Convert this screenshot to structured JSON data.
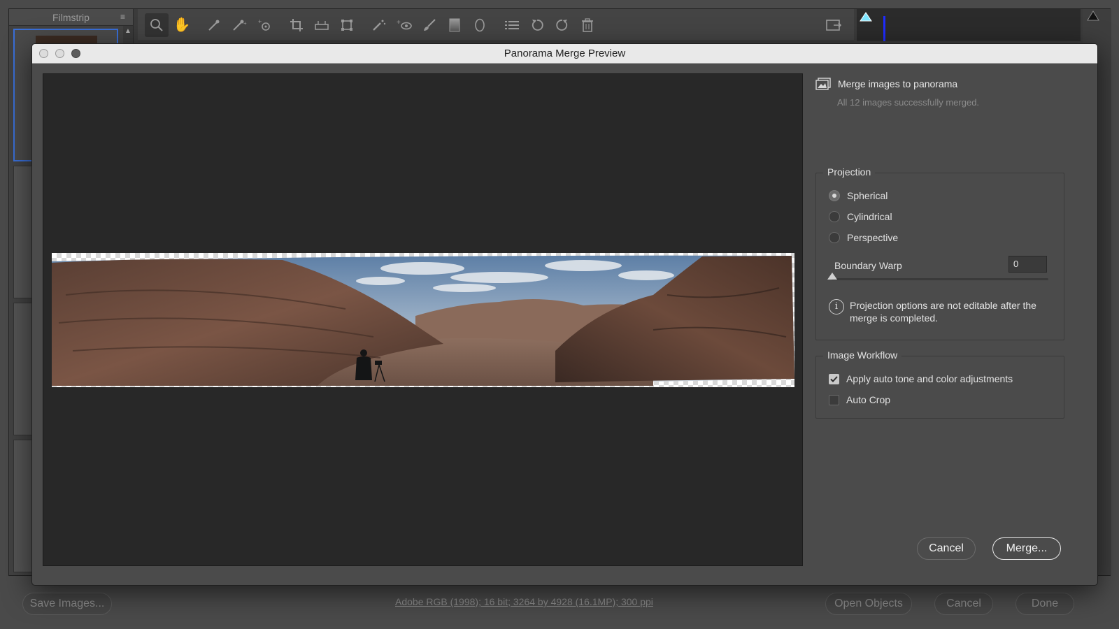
{
  "background": {
    "filmstrip": {
      "title": "Filmstrip"
    },
    "toolbar": {
      "tools": [
        "zoom-icon",
        "hand-icon",
        "white-balance-icon",
        "color-sampler-icon",
        "targeted-adjustment-icon",
        "crop-icon",
        "straighten-icon",
        "transform-icon",
        "spot-removal-icon",
        "red-eye-icon",
        "adjustment-brush-icon",
        "graduated-filter-icon",
        "radial-filter-icon",
        "list-icon",
        "rotate-left-icon",
        "rotate-right-icon",
        "trash-icon"
      ]
    },
    "footer": {
      "save_images": "Save Images...",
      "image_info": "Adobe RGB (1998); 16 bit; 3264 by 4928 (16.1MP); 300 ppi",
      "open_objects": "Open Objects",
      "cancel": "Cancel",
      "done": "Done"
    }
  },
  "dialog": {
    "title": "Panorama Merge Preview",
    "merge_head": "Merge images to panorama",
    "merge_sub": "All 12 images successfully merged.",
    "projection": {
      "legend": "Projection",
      "options": [
        "Spherical",
        "Cylindrical",
        "Perspective"
      ],
      "selected": "Spherical",
      "boundary_warp_label": "Boundary Warp",
      "boundary_warp_value": "0",
      "info": "Projection options are not editable after the merge is completed."
    },
    "workflow": {
      "legend": "Image Workflow",
      "auto_tone_label": "Apply auto tone and color adjustments",
      "auto_tone_checked": true,
      "auto_crop_label": "Auto Crop",
      "auto_crop_checked": false
    },
    "buttons": {
      "cancel": "Cancel",
      "merge": "Merge..."
    }
  },
  "colors": {
    "accent_blue": "#3a6fd8",
    "histogram_clip": "#7fe6ff"
  }
}
